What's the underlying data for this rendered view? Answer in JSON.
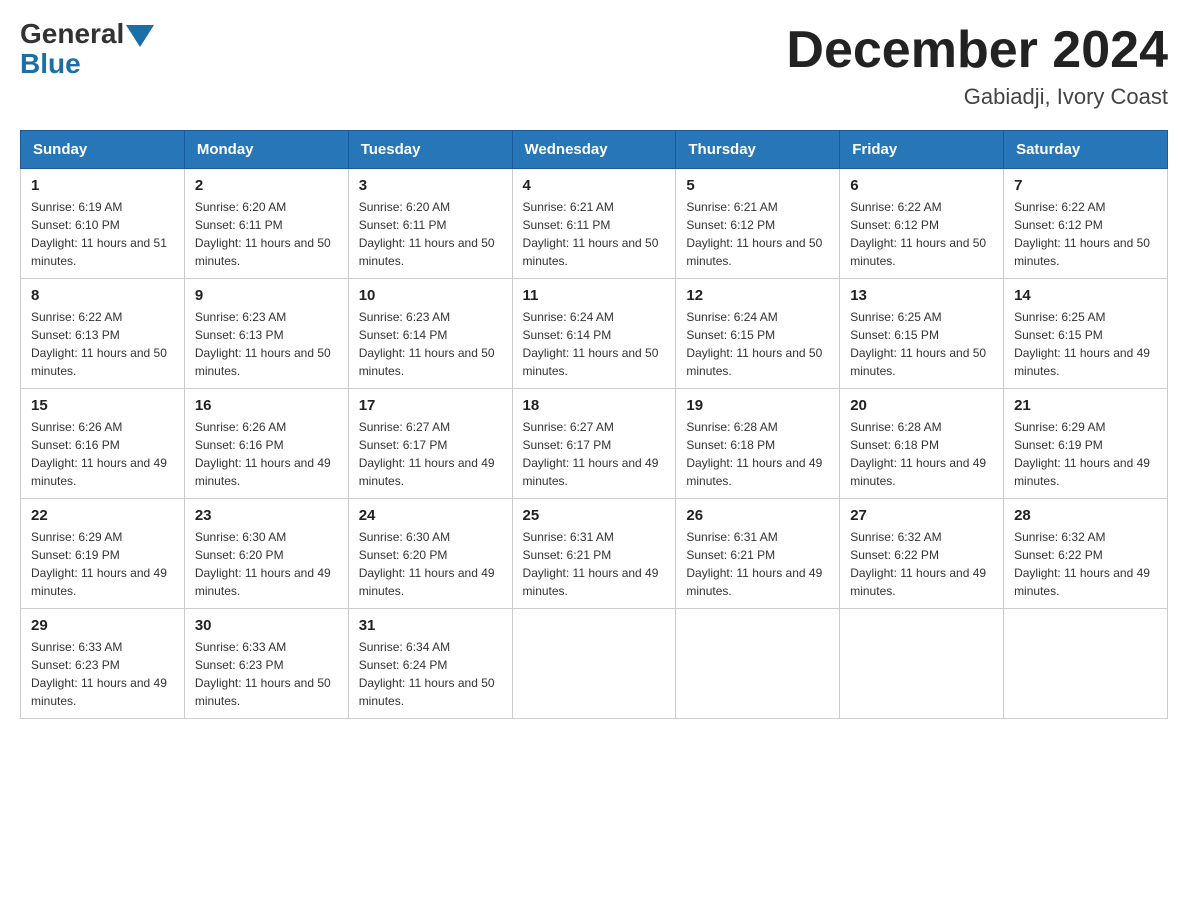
{
  "header": {
    "logo_general": "General",
    "logo_blue": "Blue",
    "month_title": "December 2024",
    "location": "Gabiadji, Ivory Coast"
  },
  "days_of_week": [
    "Sunday",
    "Monday",
    "Tuesday",
    "Wednesday",
    "Thursday",
    "Friday",
    "Saturday"
  ],
  "weeks": [
    [
      {
        "day": "1",
        "sunrise": "6:19 AM",
        "sunset": "6:10 PM",
        "daylight": "11 hours and 51 minutes."
      },
      {
        "day": "2",
        "sunrise": "6:20 AM",
        "sunset": "6:11 PM",
        "daylight": "11 hours and 50 minutes."
      },
      {
        "day": "3",
        "sunrise": "6:20 AM",
        "sunset": "6:11 PM",
        "daylight": "11 hours and 50 minutes."
      },
      {
        "day": "4",
        "sunrise": "6:21 AM",
        "sunset": "6:11 PM",
        "daylight": "11 hours and 50 minutes."
      },
      {
        "day": "5",
        "sunrise": "6:21 AM",
        "sunset": "6:12 PM",
        "daylight": "11 hours and 50 minutes."
      },
      {
        "day": "6",
        "sunrise": "6:22 AM",
        "sunset": "6:12 PM",
        "daylight": "11 hours and 50 minutes."
      },
      {
        "day": "7",
        "sunrise": "6:22 AM",
        "sunset": "6:12 PM",
        "daylight": "11 hours and 50 minutes."
      }
    ],
    [
      {
        "day": "8",
        "sunrise": "6:22 AM",
        "sunset": "6:13 PM",
        "daylight": "11 hours and 50 minutes."
      },
      {
        "day": "9",
        "sunrise": "6:23 AM",
        "sunset": "6:13 PM",
        "daylight": "11 hours and 50 minutes."
      },
      {
        "day": "10",
        "sunrise": "6:23 AM",
        "sunset": "6:14 PM",
        "daylight": "11 hours and 50 minutes."
      },
      {
        "day": "11",
        "sunrise": "6:24 AM",
        "sunset": "6:14 PM",
        "daylight": "11 hours and 50 minutes."
      },
      {
        "day": "12",
        "sunrise": "6:24 AM",
        "sunset": "6:15 PM",
        "daylight": "11 hours and 50 minutes."
      },
      {
        "day": "13",
        "sunrise": "6:25 AM",
        "sunset": "6:15 PM",
        "daylight": "11 hours and 50 minutes."
      },
      {
        "day": "14",
        "sunrise": "6:25 AM",
        "sunset": "6:15 PM",
        "daylight": "11 hours and 49 minutes."
      }
    ],
    [
      {
        "day": "15",
        "sunrise": "6:26 AM",
        "sunset": "6:16 PM",
        "daylight": "11 hours and 49 minutes."
      },
      {
        "day": "16",
        "sunrise": "6:26 AM",
        "sunset": "6:16 PM",
        "daylight": "11 hours and 49 minutes."
      },
      {
        "day": "17",
        "sunrise": "6:27 AM",
        "sunset": "6:17 PM",
        "daylight": "11 hours and 49 minutes."
      },
      {
        "day": "18",
        "sunrise": "6:27 AM",
        "sunset": "6:17 PM",
        "daylight": "11 hours and 49 minutes."
      },
      {
        "day": "19",
        "sunrise": "6:28 AM",
        "sunset": "6:18 PM",
        "daylight": "11 hours and 49 minutes."
      },
      {
        "day": "20",
        "sunrise": "6:28 AM",
        "sunset": "6:18 PM",
        "daylight": "11 hours and 49 minutes."
      },
      {
        "day": "21",
        "sunrise": "6:29 AM",
        "sunset": "6:19 PM",
        "daylight": "11 hours and 49 minutes."
      }
    ],
    [
      {
        "day": "22",
        "sunrise": "6:29 AM",
        "sunset": "6:19 PM",
        "daylight": "11 hours and 49 minutes."
      },
      {
        "day": "23",
        "sunrise": "6:30 AM",
        "sunset": "6:20 PM",
        "daylight": "11 hours and 49 minutes."
      },
      {
        "day": "24",
        "sunrise": "6:30 AM",
        "sunset": "6:20 PM",
        "daylight": "11 hours and 49 minutes."
      },
      {
        "day": "25",
        "sunrise": "6:31 AM",
        "sunset": "6:21 PM",
        "daylight": "11 hours and 49 minutes."
      },
      {
        "day": "26",
        "sunrise": "6:31 AM",
        "sunset": "6:21 PM",
        "daylight": "11 hours and 49 minutes."
      },
      {
        "day": "27",
        "sunrise": "6:32 AM",
        "sunset": "6:22 PM",
        "daylight": "11 hours and 49 minutes."
      },
      {
        "day": "28",
        "sunrise": "6:32 AM",
        "sunset": "6:22 PM",
        "daylight": "11 hours and 49 minutes."
      }
    ],
    [
      {
        "day": "29",
        "sunrise": "6:33 AM",
        "sunset": "6:23 PM",
        "daylight": "11 hours and 49 minutes."
      },
      {
        "day": "30",
        "sunrise": "6:33 AM",
        "sunset": "6:23 PM",
        "daylight": "11 hours and 50 minutes."
      },
      {
        "day": "31",
        "sunrise": "6:34 AM",
        "sunset": "6:24 PM",
        "daylight": "11 hours and 50 minutes."
      },
      null,
      null,
      null,
      null
    ]
  ]
}
